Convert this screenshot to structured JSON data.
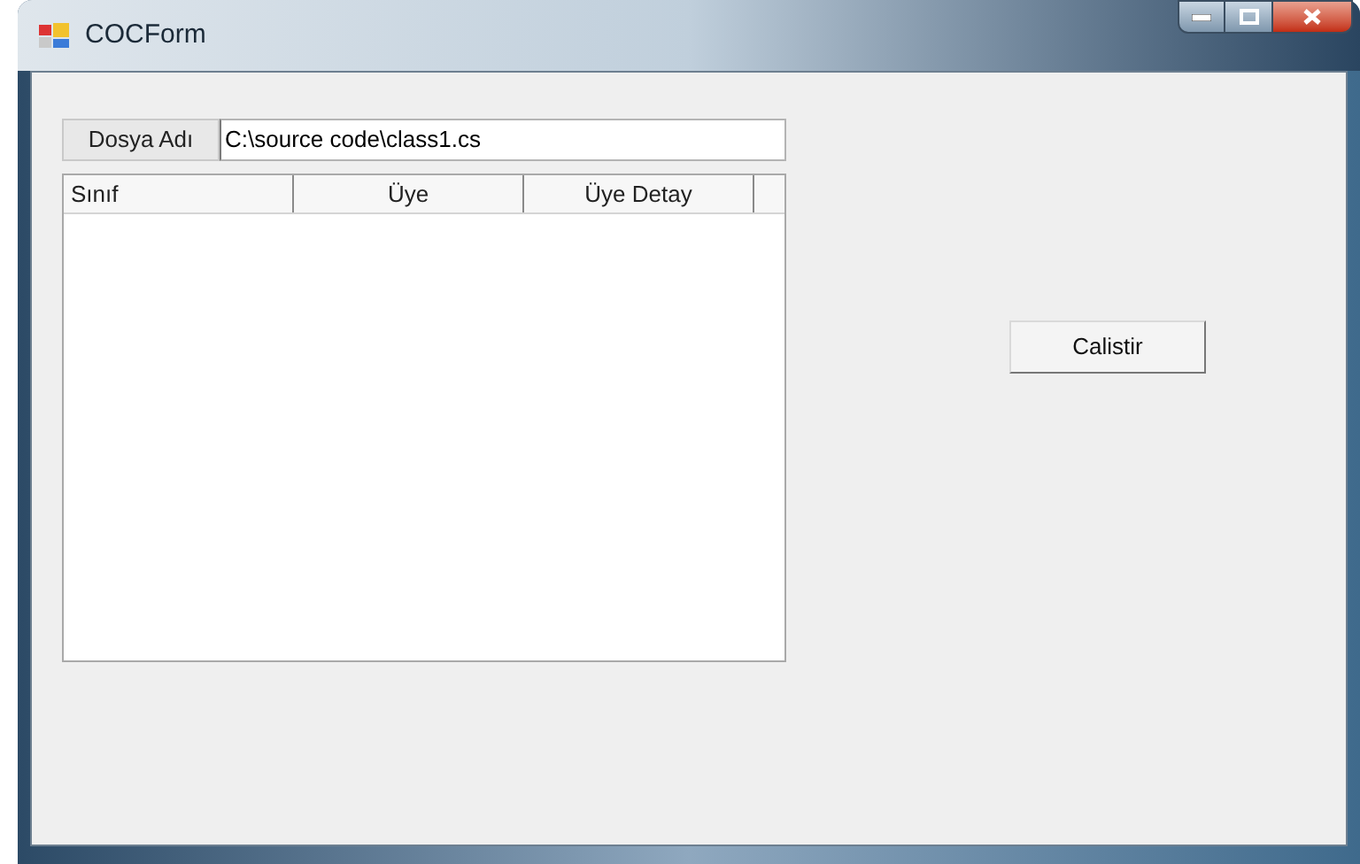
{
  "window": {
    "title": "COCForm"
  },
  "file_field": {
    "label": "Dosya Adı",
    "value": "C:\\source code\\class1.cs"
  },
  "list": {
    "columns": [
      "Sınıf",
      "Üye",
      "Üye Detay"
    ]
  },
  "buttons": [
    "Calistir"
  ]
}
